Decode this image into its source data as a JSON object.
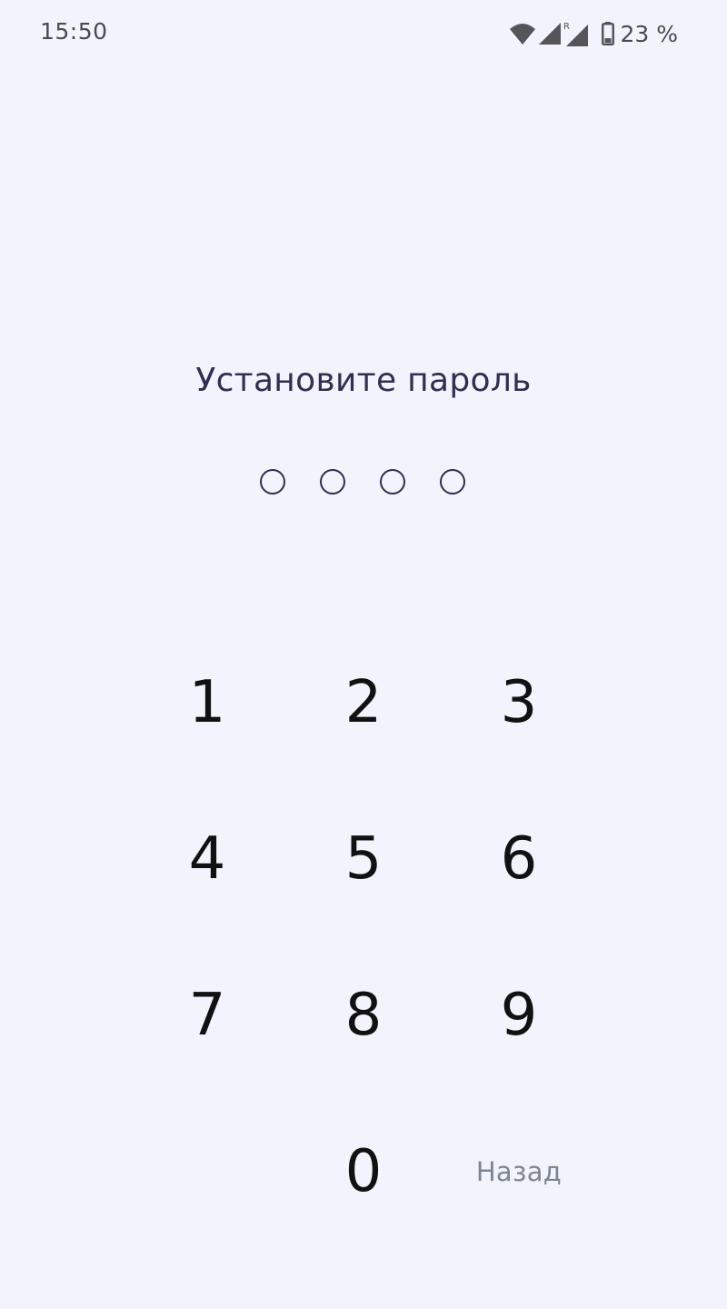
{
  "status_bar": {
    "time": "15:50",
    "battery_percent": "23 %",
    "icons": [
      "wifi-icon",
      "signal-icon",
      "roaming-signal-icon",
      "battery-icon"
    ],
    "roaming_label": "R"
  },
  "title": "Установите пароль",
  "pin": {
    "length": 4,
    "filled": 0
  },
  "keypad": {
    "keys": [
      "1",
      "2",
      "3",
      "4",
      "5",
      "6",
      "7",
      "8",
      "9",
      "0"
    ],
    "back_label": "Назад"
  },
  "colors": {
    "background": "#F3F3FD",
    "title": "#2E2F52",
    "digit": "#111111",
    "back": "#7C8593"
  }
}
